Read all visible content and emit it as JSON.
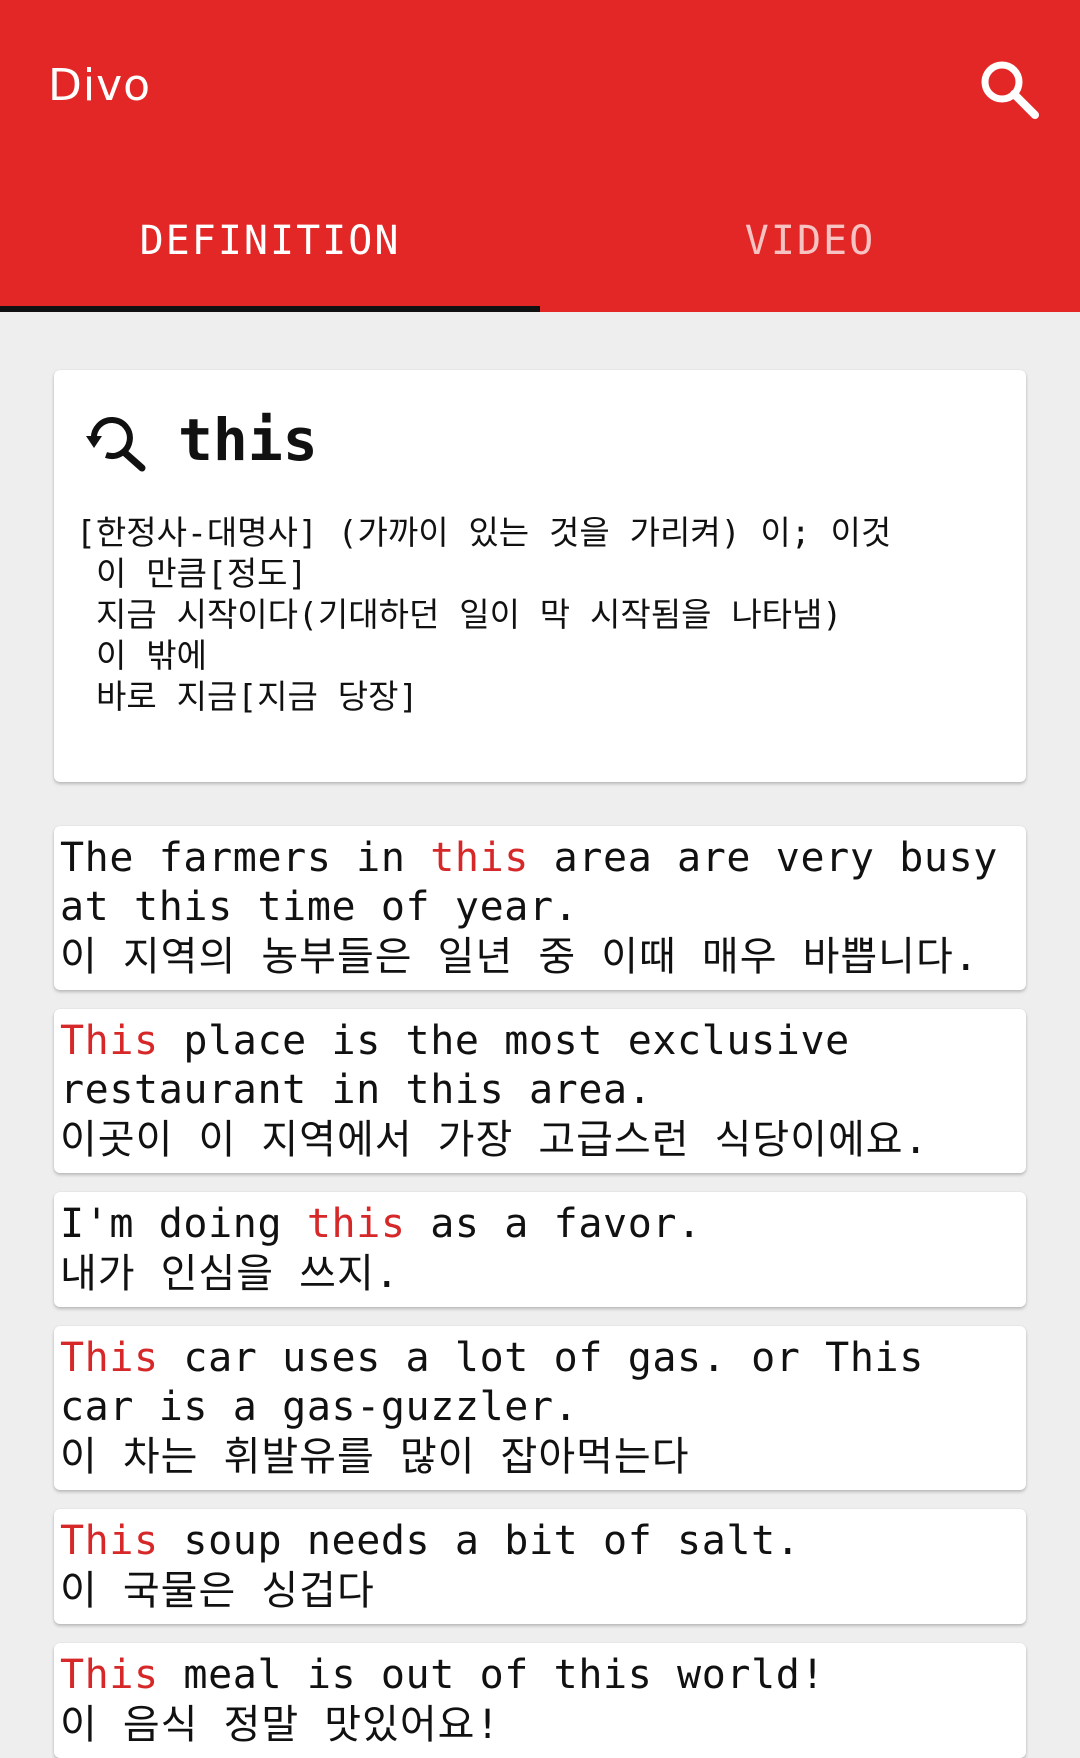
{
  "app": {
    "title": "Divo"
  },
  "tabs": [
    {
      "label": "DEFINITION",
      "active": true
    },
    {
      "label": "VIDEO",
      "active": false
    }
  ],
  "definition": {
    "word": "this",
    "lines": [
      "[한정사-대명사] (가까이 있는 것을 가리켜) 이; 이것",
      "이 만큼[정도]",
      "지금 시작이다(기대하던 일이 막 시작됨을 나타냄)",
      "이 밖에",
      "바로 지금[지금 당장]"
    ]
  },
  "examples": [
    {
      "en_before": "The farmers in ",
      "highlight": "this",
      "en_after": " area are very busy at this time of year.",
      "ko": "이 지역의 농부들은 일년 중 이때 매우 바쁩니다."
    },
    {
      "en_before": "",
      "highlight": "This",
      "en_after": " place is the most exclusive restaurant in this area.",
      "ko": "이곳이 이 지역에서 가장 고급스런 식당이에요."
    },
    {
      "en_before": "I'm doing ",
      "highlight": "this",
      "en_after": " as a favor.",
      "ko": "내가 인심을 쓰지."
    },
    {
      "en_before": "",
      "highlight": "This",
      "en_after": " car uses a lot of gas. or This car is a gas-guzzler.",
      "ko": "이 차는 휘발유를 많이 잡아먹는다"
    },
    {
      "en_before": "",
      "highlight": "This",
      "en_after": " soup needs a bit of salt.",
      "ko": "이 국물은 싱겁다"
    },
    {
      "en_before": "",
      "highlight": "This",
      "en_after": " meal is out of this world!",
      "ko": "이 음식 정말 맛있어요!"
    }
  ],
  "icons": {
    "search": "search-icon",
    "lookup": "search-history-icon"
  },
  "colors": {
    "appbar": "#e32626",
    "highlight": "#d62828",
    "background": "#eeeeee"
  }
}
